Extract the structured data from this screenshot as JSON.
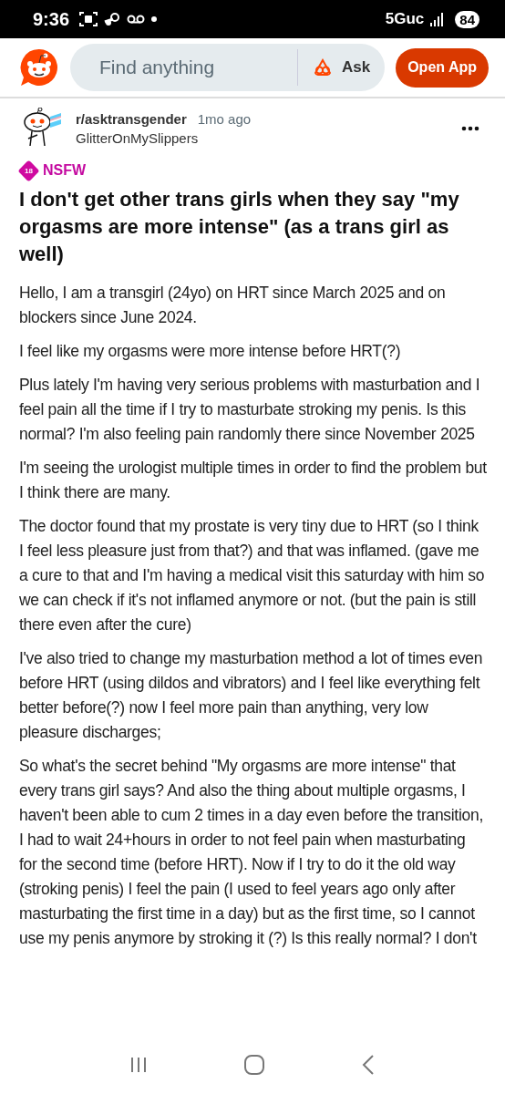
{
  "status_bar": {
    "time": "9:36",
    "network": "5Guc",
    "battery": "84"
  },
  "header": {
    "search": {
      "placeholder": "Find anything"
    },
    "ask_label": "Ask",
    "open_app_label": "Open App"
  },
  "post": {
    "subreddit": "r/asktransgender",
    "age": "1mo ago",
    "author": "GlitterOnMySlippers",
    "nsfw": {
      "badge": "18",
      "label": "NSFW"
    },
    "title": "I don't get other trans girls when they say \"my orgasms are more intense\" (as a trans girl as well)",
    "paragraphs": [
      "Hello, I am a transgirl (24yo) on HRT since March 2025 and on blockers since June 2024.",
      "I feel like my orgasms were more intense before HRT(?)",
      "Plus lately I'm having very serious problems with masturbation and I feel pain all the time if I try to masturbate stroking my penis. Is this normal? I'm also feeling pain randomly there since November 2025",
      "I'm seeing the urologist multiple times in order to find the problem but I think there are many.",
      "The doctor found that my prostate is very tiny due to HRT (so I think I feel less pleasure just from that?) and that was inflamed. (gave me a cure to that and I'm having a medical visit this saturday with him so we can check if it's not inflamed anymore or not. (but the pain is still there even after the cure)",
      "I've also tried to change my masturbation method a lot of times even before HRT (using dildos and vibrators) and I feel like everything felt better before(?) now I feel more pain than anything, very low pleasure discharges;",
      "So what's the secret behind \"My orgasms are more intense\" that every trans girl says? And also the thing about multiple orgasms, I haven't been able to cum 2 times in a day even before the transition, I had to wait 24+hours in order to not feel pain when masturbating for the second time (before HRT). Now if I try to do it the old way (stroking penis) I feel the pain (I used to feel years ago only after masturbating the first time in a day) but as the first time, so I cannot use my penis anymore by stroking it (?) Is this really normal? I don't"
    ]
  }
}
